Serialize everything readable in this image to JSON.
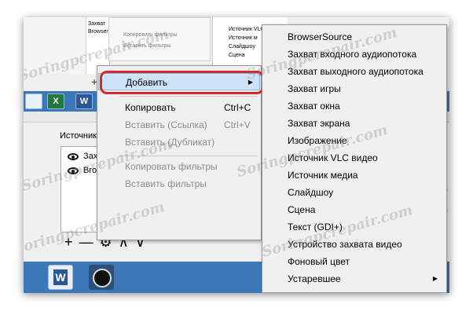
{
  "background_old_menu": {
    "sources_mini": [
      "Захват",
      "Browser"
    ],
    "menu_items": [
      "Копировать фильтры",
      "Вставить фильтры"
    ],
    "source_types_mini": [
      "Источник VLC",
      "Источник м",
      "Слайдшоу",
      "Сцена"
    ]
  },
  "sources_panel": {
    "label": "Источник",
    "items": [
      {
        "name": "Зах"
      },
      {
        "name": "Bro"
      }
    ],
    "toolbar": [
      "+",
      "—",
      "⚙",
      "∧",
      "∨"
    ]
  },
  "context_menu": {
    "items": [
      {
        "label": "Добавить",
        "shortcut": "",
        "disabled": false,
        "highlighted": true,
        "has_submenu": true
      },
      {
        "label": "Копировать",
        "shortcut": "Ctrl+C",
        "disabled": false
      },
      {
        "label": "Вставить (Ссылка)",
        "shortcut": "Ctrl+V",
        "disabled": true
      },
      {
        "label": "Вставить (Дубликат)",
        "shortcut": "",
        "disabled": true
      },
      {
        "label": "Копировать фильтры",
        "shortcut": "",
        "disabled": true
      },
      {
        "label": "Вставить фильтры",
        "shortcut": "",
        "disabled": true
      }
    ]
  },
  "add_submenu": {
    "items": [
      "BrowserSource",
      "Захват входного аудиопотока",
      "Захват выходного аудиопотока",
      "Захват игры",
      "Захват окна",
      "Захват экрана",
      "Изображение",
      "Источник VLC видео",
      "Источник медиа",
      "Слайдшоу",
      "Сцена",
      "Текст (GDI+)",
      "Устройство захвата видео",
      "Фоновый цвет",
      "Устаревшее"
    ]
  },
  "watermark": "Soringpcrepair.com",
  "colors": {
    "highlight_ring": "#d8262a",
    "menu_hover": "#cfe3f8",
    "taskbar": "#3c77b8"
  }
}
